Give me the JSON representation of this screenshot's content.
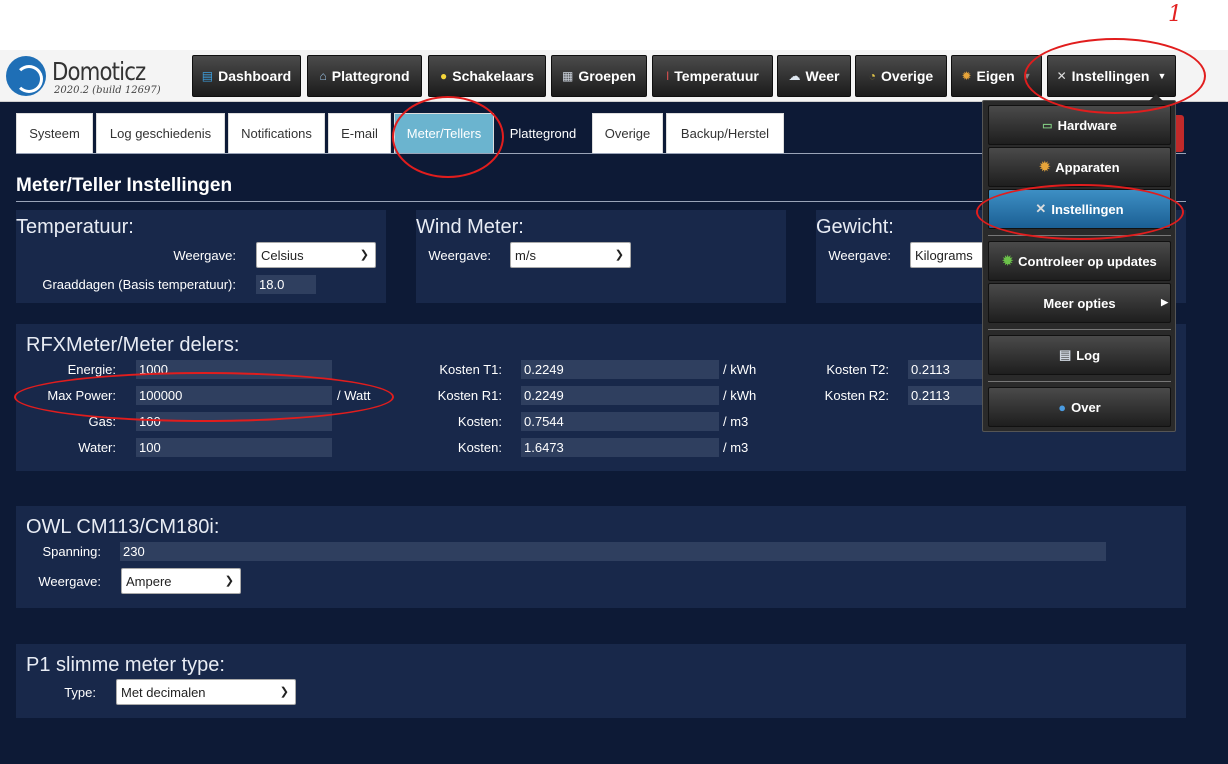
{
  "annotation_number": "1",
  "logo": {
    "name": "Domoticz",
    "version": "2020.2 (build 12697)"
  },
  "nav": [
    {
      "label": "Dashboard",
      "icon": "dashboard-icon"
    },
    {
      "label": "Plattegrond",
      "icon": "house-icon"
    },
    {
      "label": "Schakelaars",
      "icon": "lightbulb-icon"
    },
    {
      "label": "Groepen",
      "icon": "clapperboard-icon"
    },
    {
      "label": "Temperatuur",
      "icon": "thermometer-icon"
    },
    {
      "label": "Weer",
      "icon": "cloud-icon"
    },
    {
      "label": "Overige",
      "icon": "gauge-icon"
    },
    {
      "label": "Eigen",
      "icon": "gear-icon"
    },
    {
      "label": "Instellingen",
      "icon": "tools-icon"
    }
  ],
  "tabs": [
    {
      "label": "Systeem"
    },
    {
      "label": "Log geschiedenis"
    },
    {
      "label": "Notifications"
    },
    {
      "label": "E-mail"
    },
    {
      "label": "Meter/Tellers",
      "active": true
    },
    {
      "label": "Plattegrond"
    },
    {
      "label": "Overige"
    },
    {
      "label": "Backup/Herstel"
    }
  ],
  "page_title": "Meter/Teller Instellingen",
  "temperatuur": {
    "title": "Temperatuur:",
    "weergave_label": "Weergave:",
    "weergave_value": "Celsius",
    "graaddagen_label": "Graaddagen (Basis temperatuur):",
    "graaddagen_value": "18.0"
  },
  "wind": {
    "title": "Wind Meter:",
    "weergave_label": "Weergave:",
    "weergave_value": "m/s"
  },
  "gewicht": {
    "title": "Gewicht:",
    "weergave_label": "Weergave:",
    "weergave_value": "Kilograms"
  },
  "rfx": {
    "title": "RFXMeter/Meter delers:",
    "energie_label": "Energie:",
    "energie_value": "1000",
    "maxpower_label": "Max Power:",
    "maxpower_value": "100000",
    "maxpower_unit": "/ Watt",
    "gas_label": "Gas:",
    "gas_value": "100",
    "water_label": "Water:",
    "water_value": "100",
    "t1_label": "Kosten T1:",
    "t1_value": "0.2249",
    "t1_unit": "/ kWh",
    "r1_label": "Kosten R1:",
    "r1_value": "0.2249",
    "r1_unit": "/ kWh",
    "gas_kosten_label": "Kosten:",
    "gas_kosten_value": "0.7544",
    "gas_kosten_unit": "/ m3",
    "water_kosten_label": "Kosten:",
    "water_kosten_value": "1.6473",
    "water_kosten_unit": "/ m3",
    "t2_label": "Kosten T2:",
    "t2_value": "0.2113",
    "r2_label": "Kosten R2:",
    "r2_value": "0.2113"
  },
  "owl": {
    "title": "OWL CM113/CM180i:",
    "spanning_label": "Spanning:",
    "spanning_value": "230",
    "weergave_label": "Weergave:",
    "weergave_value": "Ampere"
  },
  "p1": {
    "title": "P1 slimme meter type:",
    "type_label": "Type:",
    "type_value": "Met decimalen"
  },
  "dropdown": {
    "hardware": "Hardware",
    "apparaten": "Apparaten",
    "instellingen": "Instellingen",
    "updates": "Controleer op updates",
    "meer": "Meer opties",
    "log": "Log",
    "over": "Over"
  },
  "colors": {
    "background": "#0d1a36",
    "panel": "#18284a",
    "active_tab": "#6bb4cf",
    "active_menu": "#2577b0",
    "annotation": "#e11d1d"
  }
}
